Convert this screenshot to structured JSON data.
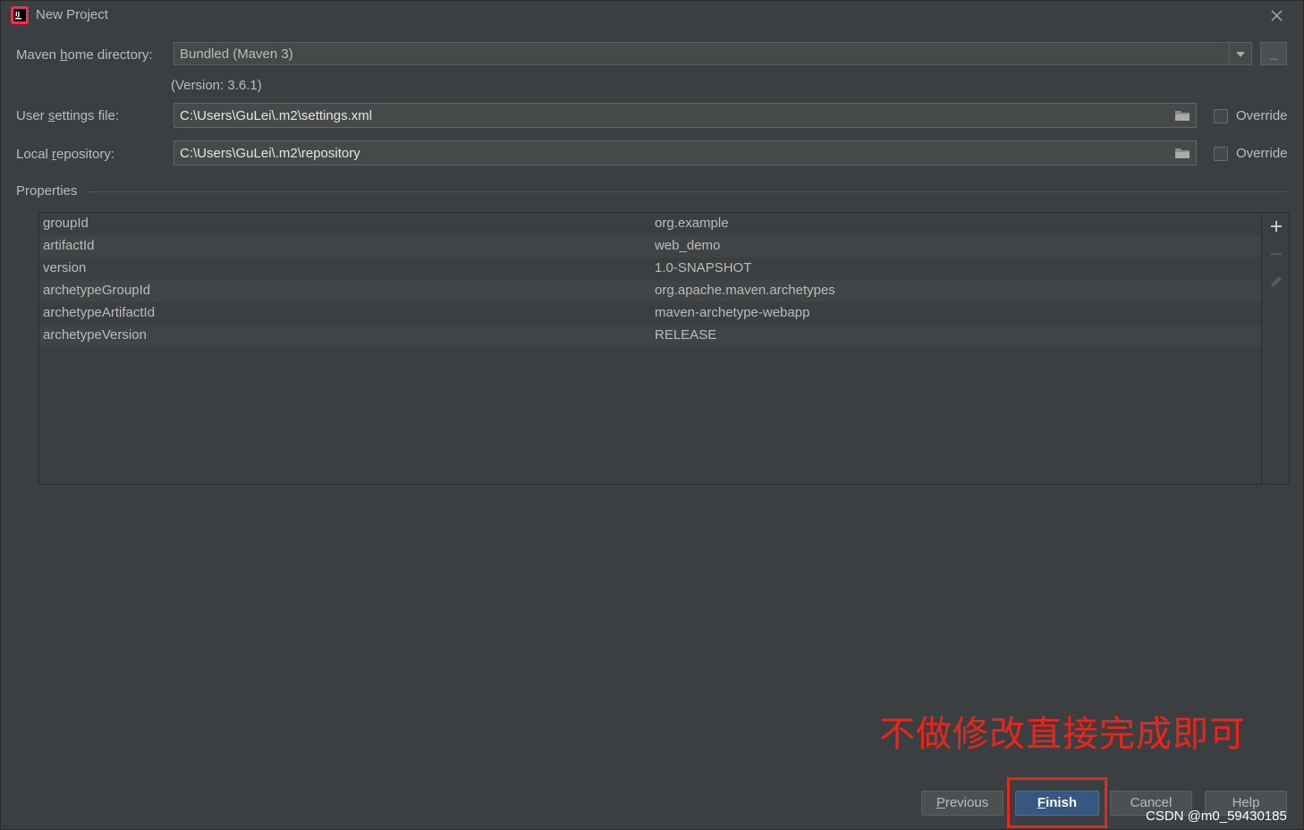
{
  "window": {
    "title": "New Project"
  },
  "maven": {
    "home_label_pre": "Maven ",
    "home_label_u": "h",
    "home_label_post": "ome directory:",
    "home_value": "Bundled (Maven 3)",
    "browse_label": "...",
    "version": "(Version: 3.6.1)",
    "settings_label_pre": "User ",
    "settings_label_u": "s",
    "settings_label_post": "ettings file:",
    "settings_value": "C:\\Users\\GuLei\\.m2\\settings.xml",
    "settings_override": "Override",
    "repo_label_pre": "Local ",
    "repo_label_u": "r",
    "repo_label_post": "epository:",
    "repo_value": "C:\\Users\\GuLei\\.m2\\repository",
    "repo_override": "Override"
  },
  "properties": {
    "label": "Properties",
    "rows": [
      {
        "key": "groupId",
        "value": "org.example"
      },
      {
        "key": "artifactId",
        "value": "web_demo"
      },
      {
        "key": "version",
        "value": "1.0-SNAPSHOT"
      },
      {
        "key": "archetypeGroupId",
        "value": "org.apache.maven.archetypes"
      },
      {
        "key": "archetypeArtifactId",
        "value": "maven-archetype-webapp"
      },
      {
        "key": "archetypeVersion",
        "value": "RELEASE"
      }
    ]
  },
  "annotation": "不做修改直接完成即可",
  "buttons": {
    "previous_u": "P",
    "previous_rest": "revious",
    "finish_u": "F",
    "finish_rest": "inish",
    "cancel": "Cancel",
    "help": "Help"
  },
  "watermark": "CSDN @m0_59430185",
  "colors": {
    "accent": "#365880",
    "annotation": "#e8261c",
    "background": "#3c3f41"
  }
}
